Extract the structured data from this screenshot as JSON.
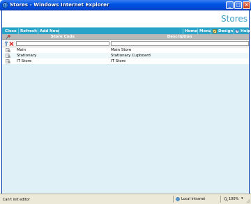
{
  "window": {
    "title": "Stores - Windows Internet Explorer",
    "minimize_label": "_",
    "maximize_label": "□",
    "close_label": "×"
  },
  "header": {
    "page_title": "Stores"
  },
  "toolbar": {
    "left_buttons": [
      "Close",
      "Refresh",
      "Add New"
    ],
    "right_buttons": [
      "Home",
      "Menu",
      "Design",
      "Help"
    ]
  },
  "grid": {
    "columns": [
      "Store Code",
      "Description"
    ],
    "filter": {
      "code_value": "",
      "description_value": ""
    },
    "rows": [
      {
        "code": "Main",
        "description": "Main Store"
      },
      {
        "code": "Stationary",
        "description": "Stationary Cupboard"
      },
      {
        "code": "IT Store",
        "description": "IT Store"
      }
    ]
  },
  "statusbar": {
    "status_text": "Can't init editor",
    "zone": "Local intranet",
    "zoom": "100%",
    "zoom_arrow": "▾"
  },
  "colors": {
    "toolbar": "#2aa3c8",
    "page_title": "#3c9fc7",
    "grid_header": "#b8b8b8",
    "grid_body": "#dff1f6",
    "title_bar": "#0054e3"
  }
}
